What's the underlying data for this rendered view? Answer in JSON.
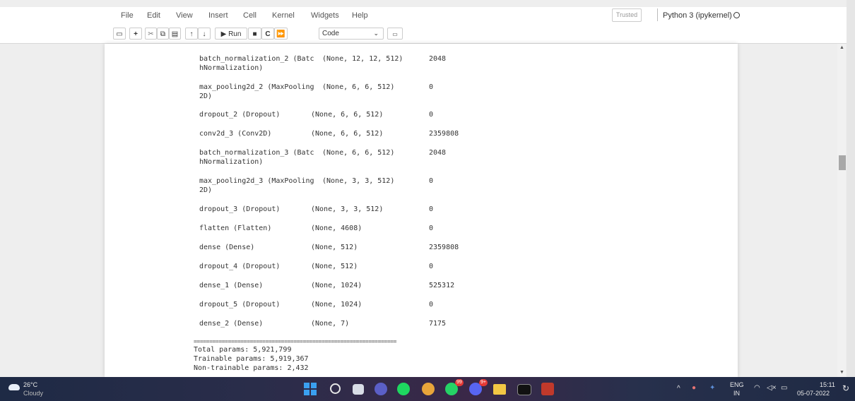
{
  "menu": {
    "items": [
      "File",
      "Edit",
      "View",
      "Insert",
      "Cell",
      "Kernel",
      "Widgets",
      "Help"
    ],
    "trusted": "Trusted",
    "kernel": "Python 3 (ipykernel)"
  },
  "toolbar": {
    "run_label": "Run",
    "cell_type": "Code"
  },
  "summary_rows": [
    {
      "layer": "batch_normalization_2 (Batc",
      "layer2": "hNormalization)",
      "shape": "(None, 12, 12, 512)",
      "params": "2048"
    },
    {
      "layer": "max_pooling2d_2 (MaxPooling",
      "layer2": "2D)",
      "shape": "(None, 6, 6, 512)",
      "params": "0"
    },
    {
      "layer": "dropout_2 (Dropout)",
      "layer2": "",
      "shape": "(None, 6, 6, 512)",
      "params": "0"
    },
    {
      "layer": "conv2d_3 (Conv2D)",
      "layer2": "",
      "shape": "(None, 6, 6, 512)",
      "params": "2359808"
    },
    {
      "layer": "batch_normalization_3 (Batc",
      "layer2": "hNormalization)",
      "shape": "(None, 6, 6, 512)",
      "params": "2048"
    },
    {
      "layer": "max_pooling2d_3 (MaxPooling",
      "layer2": "2D)",
      "shape": "(None, 3, 3, 512)",
      "params": "0"
    },
    {
      "layer": "dropout_3 (Dropout)",
      "layer2": "",
      "shape": "(None, 3, 3, 512)",
      "params": "0"
    },
    {
      "layer": "flatten (Flatten)",
      "layer2": "",
      "shape": "(None, 4608)",
      "params": "0"
    },
    {
      "layer": "dense (Dense)",
      "layer2": "",
      "shape": "(None, 512)",
      "params": "2359808"
    },
    {
      "layer": "dropout_4 (Dropout)",
      "layer2": "",
      "shape": "(None, 512)",
      "params": "0"
    },
    {
      "layer": "dense_1 (Dense)",
      "layer2": "",
      "shape": "(None, 1024)",
      "params": "525312"
    },
    {
      "layer": "dropout_5 (Dropout)",
      "layer2": "",
      "shape": "(None, 1024)",
      "params": "0"
    },
    {
      "layer": "dense_2 (Dense)",
      "layer2": "",
      "shape": "(None, 7)",
      "params": "7175"
    }
  ],
  "summary_footer": {
    "separator": "=================================================================",
    "total": "Total params: 5,921,799",
    "trainable": "Trainable params: 5,919,367",
    "non_trainable": "Non-trainable params: 2,432"
  },
  "taskbar": {
    "weather_temp": "26°C",
    "weather_desc": "Cloudy",
    "lang_line1": "ENG",
    "lang_line2": "IN",
    "time": "15:11",
    "date": "05-07-2022",
    "badge_whatsapp": "99",
    "badge_discord": "9+"
  },
  "colors": {
    "taskbar_bg": "#24294a",
    "page_bg": "#ffffff",
    "outer_bg": "#eeeeee",
    "windows_blue": "#3aa0f0"
  }
}
